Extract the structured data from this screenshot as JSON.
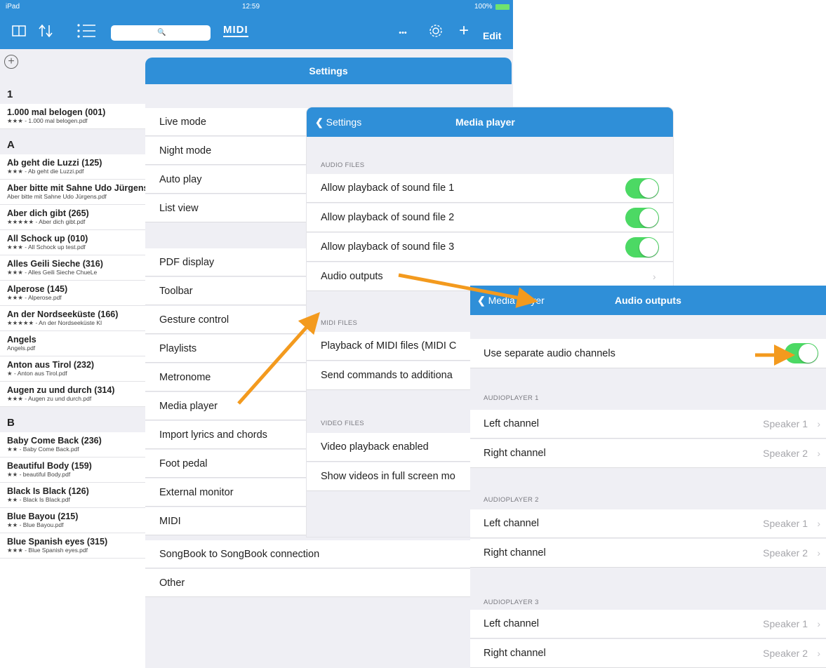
{
  "statusbar": {
    "carrier": "iPad",
    "time": "12:59",
    "battery": "100%"
  },
  "toolbar": {
    "search_icon": "🔍",
    "midi_label": "MIDI",
    "more_icon": "•••",
    "edit_label": "Edit"
  },
  "songlist": {
    "sections": [
      {
        "letter": "1",
        "songs": [
          {
            "title": "1.000 mal belogen (001)",
            "sub": "★★★ - 1.000 mal belogen.pdf"
          }
        ]
      },
      {
        "letter": "A",
        "songs": [
          {
            "title": "Ab geht die Luzzi (125)",
            "sub": "★★★ - Ab geht die Luzzi.pdf"
          },
          {
            "title": "Aber bitte mit Sahne Udo Jürgens",
            "sub": "Aber bitte mit Sahne Udo Jürgens.pdf"
          },
          {
            "title": "Aber dich gibt (265)",
            "sub": "★★★★★ - Aber dich gibt.pdf"
          },
          {
            "title": "All Schock up (010)",
            "sub": "★★★ - All Schock up test.pdf"
          },
          {
            "title": "Alles Geili Sieche (316)",
            "sub": "★★★ - Alles Geili Sieche   ChueLe"
          },
          {
            "title": "Alperose (145)",
            "sub": "★★★ - Alperose.pdf"
          },
          {
            "title": "An der Nordseeküste (166)",
            "sub": "★★★★★ - An der Nordseeküste Kl"
          },
          {
            "title": "Angels",
            "sub": "Angels.pdf"
          },
          {
            "title": "Anton aus Tirol (232)",
            "sub": "★ - Anton aus Tirol.pdf"
          },
          {
            "title": "Augen zu und durch (314)",
            "sub": "★★★ - Augen zu und durch.pdf"
          }
        ]
      },
      {
        "letter": "B",
        "songs": [
          {
            "title": "Baby Come Back (236)",
            "sub": "★★ - Baby Come Back.pdf"
          },
          {
            "title": "Beautiful Body (159)",
            "sub": "★★ - beautiful Body.pdf"
          },
          {
            "title": "Black Is Black (126)",
            "sub": "★★ - Black Is Black.pdf"
          },
          {
            "title": "Blue Bayou (215)",
            "sub": "★★ - Blue Bayou.pdf"
          },
          {
            "title": "Blue Spanish eyes (315)",
            "sub": "★★★ - Blue Spanish eyes.pdf"
          }
        ]
      }
    ]
  },
  "settings": {
    "title": "Settings",
    "items": [
      "Live mode",
      "Night mode",
      "Auto play",
      "List view",
      "PDF display",
      "Toolbar",
      "Gesture control",
      "Playlists",
      "Metronome",
      "Media player",
      "Import lyrics and chords",
      "Foot pedal",
      "External monitor",
      "MIDI",
      "SongBook to SongBook connection",
      "Other"
    ]
  },
  "media_player": {
    "back_label": "Settings",
    "title": "Media player",
    "audio_section": "AUDIO FILES",
    "audio_rows": [
      "Allow playback of sound file 1",
      "Allow playback of sound file 2",
      "Allow playback of sound file 3"
    ],
    "audio_outputs": "Audio outputs",
    "midi_section": "MIDI FILES",
    "midi_rows": [
      "Playback of MIDI files (MIDI C",
      "Send commands to additiona"
    ],
    "video_section": "VIDEO FILES",
    "video_rows": [
      "Video playback enabled",
      "Show videos in full screen mo"
    ]
  },
  "audio_outputs": {
    "back_label": "Media player",
    "title": "Audio outputs",
    "separate_label": "Use separate audio channels",
    "players": [
      {
        "label": "AUDIOPLAYER 1",
        "left": "Left channel",
        "left_val": "Speaker 1",
        "right": "Right channel",
        "right_val": "Speaker 2"
      },
      {
        "label": "AUDIOPLAYER 2",
        "left": "Left channel",
        "left_val": "Speaker 1",
        "right": "Right channel",
        "right_val": "Speaker 2"
      },
      {
        "label": "AUDIOPLAYER 3",
        "left": "Left channel",
        "left_val": "Speaker 1",
        "right": "Right channel",
        "right_val": "Speaker 2"
      }
    ]
  },
  "colors": {
    "accent": "#2f8fd8",
    "toggle_on": "#4cd964",
    "arrow": "#f39a1e"
  }
}
